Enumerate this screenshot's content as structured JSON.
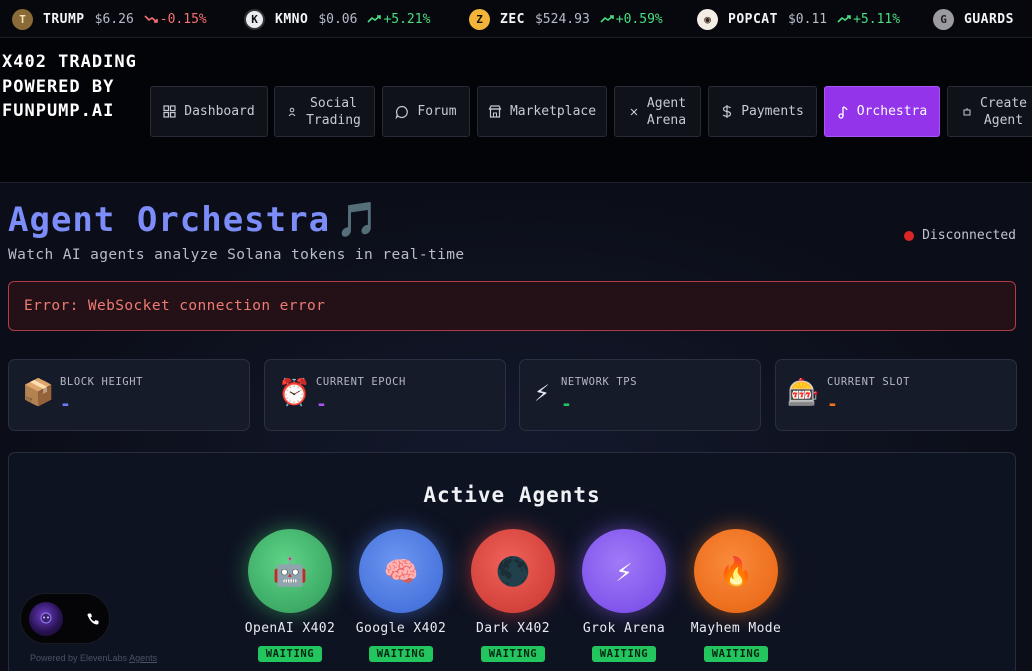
{
  "ticker": [
    {
      "symbol": "TRUMP",
      "price": "$6.26",
      "change": "-0.15%",
      "dir": "down",
      "coin_color": "#8a6a36",
      "coin_glyph": "T"
    },
    {
      "symbol": "KMNO",
      "price": "$0.06",
      "change": "+5.21%",
      "dir": "up",
      "coin_color": "#e9ecf2",
      "coin_glyph": "K"
    },
    {
      "symbol": "ZEC",
      "price": "$524.93",
      "change": "+0.59%",
      "dir": "up",
      "coin_color": "#f2b53a",
      "coin_glyph": "Z"
    },
    {
      "symbol": "POPCAT",
      "price": "$0.11",
      "change": "+5.11%",
      "dir": "up",
      "coin_color": "#f4ede6",
      "coin_glyph": "◉"
    },
    {
      "symbol": "GUARDS",
      "price": "",
      "change": "",
      "dir": "up",
      "coin_color": "#9a9aa0",
      "coin_glyph": "G"
    }
  ],
  "brand": {
    "title": "X402 TRADING POWERED BY FUNPUMP.AI"
  },
  "nav": [
    {
      "label": "Dashboard",
      "icon": "dashboard-icon",
      "active": false
    },
    {
      "label": "Social\nTrading",
      "icon": "users-icon",
      "active": false
    },
    {
      "label": "Forum",
      "icon": "chat-icon",
      "active": false
    },
    {
      "label": "Marketplace",
      "icon": "store-icon",
      "active": false
    },
    {
      "label": "Agent\nArena",
      "icon": "swords-icon",
      "active": false
    },
    {
      "label": "Payments",
      "icon": "dollar-icon",
      "active": false
    },
    {
      "label": "Orchestra",
      "icon": "music-note-icon",
      "active": true
    },
    {
      "label": "Create\nAgent",
      "icon": "bot-icon",
      "active": false
    }
  ],
  "page": {
    "title": "Agent Orchestra",
    "title_emoji": "🎵",
    "subtitle": "Watch AI agents analyze Solana tokens in real-time",
    "status": "Disconnected",
    "error": "Error: WebSocket connection error"
  },
  "stats": [
    {
      "emoji": "📦",
      "label": "BLOCK HEIGHT",
      "value": "-",
      "color": "#6b7ef6"
    },
    {
      "emoji": "⏰",
      "label": "CURRENT EPOCH",
      "value": "-",
      "color": "#a855f7"
    },
    {
      "emoji": "⚡",
      "label": "NETWORK TPS",
      "value": "-",
      "color": "#22c55e"
    },
    {
      "emoji": "🎰",
      "label": "CURRENT SLOT",
      "value": "-",
      "color": "#f97316"
    }
  ],
  "agents_section": {
    "title": "Active Agents",
    "agents": [
      {
        "name": "OpenAI X402",
        "emoji": "🤖",
        "status": "WAITING",
        "color": "#3fb86a"
      },
      {
        "name": "Google X402",
        "emoji": "🧠",
        "status": "WAITING",
        "color": "#4f7ee8"
      },
      {
        "name": "Dark X402",
        "emoji": "🌑",
        "status": "WAITING",
        "color": "#e0453f"
      },
      {
        "name": "Grok Arena",
        "emoji": "⚡",
        "status": "WAITING",
        "color": "#8b5cf6"
      },
      {
        "name": "Mayhem Mode",
        "emoji": "🔥",
        "status": "WAITING",
        "color": "#f97316"
      }
    ]
  },
  "widget": {
    "powered_prefix": "Powered by ElevenLabs",
    "powered_link": "Agents"
  }
}
